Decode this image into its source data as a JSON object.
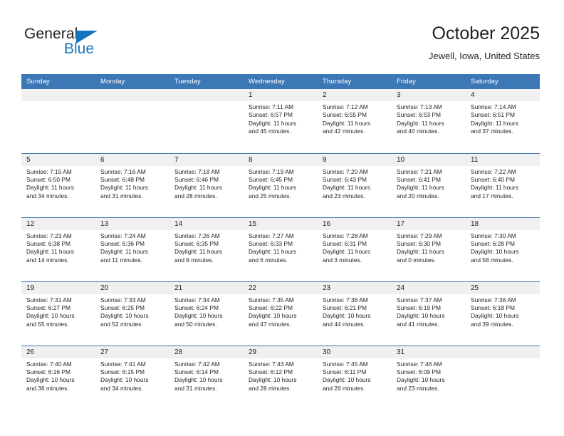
{
  "branding": {
    "logo_text_primary": "General",
    "logo_text_secondary": "Blue",
    "logo_triangle_color": "#1574bc",
    "logo_secondary_color": "#1b75bb"
  },
  "header": {
    "title": "October 2025",
    "subtitle": "Jewell, Iowa, United States"
  },
  "theme": {
    "header_row_bg": "#3c77b6",
    "header_row_text": "#ffffff",
    "daynum_bg": "#f0f0f0",
    "divider_color": "#3c77b6",
    "body_text": "#231f20",
    "page_bg": "#ffffff"
  },
  "calendar": {
    "weekday_headers": [
      "Sunday",
      "Monday",
      "Tuesday",
      "Wednesday",
      "Thursday",
      "Friday",
      "Saturday"
    ],
    "weeks": [
      [
        {
          "day": "",
          "lines": []
        },
        {
          "day": "",
          "lines": []
        },
        {
          "day": "",
          "lines": []
        },
        {
          "day": "1",
          "lines": [
            "Sunrise: 7:11 AM",
            "Sunset: 6:57 PM",
            "Daylight: 11 hours",
            "and 45 minutes."
          ]
        },
        {
          "day": "2",
          "lines": [
            "Sunrise: 7:12 AM",
            "Sunset: 6:55 PM",
            "Daylight: 11 hours",
            "and 42 minutes."
          ]
        },
        {
          "day": "3",
          "lines": [
            "Sunrise: 7:13 AM",
            "Sunset: 6:53 PM",
            "Daylight: 11 hours",
            "and 40 minutes."
          ]
        },
        {
          "day": "4",
          "lines": [
            "Sunrise: 7:14 AM",
            "Sunset: 6:51 PM",
            "Daylight: 11 hours",
            "and 37 minutes."
          ]
        }
      ],
      [
        {
          "day": "5",
          "lines": [
            "Sunrise: 7:15 AM",
            "Sunset: 6:50 PM",
            "Daylight: 11 hours",
            "and 34 minutes."
          ]
        },
        {
          "day": "6",
          "lines": [
            "Sunrise: 7:16 AM",
            "Sunset: 6:48 PM",
            "Daylight: 11 hours",
            "and 31 minutes."
          ]
        },
        {
          "day": "7",
          "lines": [
            "Sunrise: 7:18 AM",
            "Sunset: 6:46 PM",
            "Daylight: 11 hours",
            "and 28 minutes."
          ]
        },
        {
          "day": "8",
          "lines": [
            "Sunrise: 7:19 AM",
            "Sunset: 6:45 PM",
            "Daylight: 11 hours",
            "and 25 minutes."
          ]
        },
        {
          "day": "9",
          "lines": [
            "Sunrise: 7:20 AM",
            "Sunset: 6:43 PM",
            "Daylight: 11 hours",
            "and 23 minutes."
          ]
        },
        {
          "day": "10",
          "lines": [
            "Sunrise: 7:21 AM",
            "Sunset: 6:41 PM",
            "Daylight: 11 hours",
            "and 20 minutes."
          ]
        },
        {
          "day": "11",
          "lines": [
            "Sunrise: 7:22 AM",
            "Sunset: 6:40 PM",
            "Daylight: 11 hours",
            "and 17 minutes."
          ]
        }
      ],
      [
        {
          "day": "12",
          "lines": [
            "Sunrise: 7:23 AM",
            "Sunset: 6:38 PM",
            "Daylight: 11 hours",
            "and 14 minutes."
          ]
        },
        {
          "day": "13",
          "lines": [
            "Sunrise: 7:24 AM",
            "Sunset: 6:36 PM",
            "Daylight: 11 hours",
            "and 11 minutes."
          ]
        },
        {
          "day": "14",
          "lines": [
            "Sunrise: 7:26 AM",
            "Sunset: 6:35 PM",
            "Daylight: 11 hours",
            "and 9 minutes."
          ]
        },
        {
          "day": "15",
          "lines": [
            "Sunrise: 7:27 AM",
            "Sunset: 6:33 PM",
            "Daylight: 11 hours",
            "and 6 minutes."
          ]
        },
        {
          "day": "16",
          "lines": [
            "Sunrise: 7:28 AM",
            "Sunset: 6:31 PM",
            "Daylight: 11 hours",
            "and 3 minutes."
          ]
        },
        {
          "day": "17",
          "lines": [
            "Sunrise: 7:29 AM",
            "Sunset: 6:30 PM",
            "Daylight: 11 hours",
            "and 0 minutes."
          ]
        },
        {
          "day": "18",
          "lines": [
            "Sunrise: 7:30 AM",
            "Sunset: 6:28 PM",
            "Daylight: 10 hours",
            "and 58 minutes."
          ]
        }
      ],
      [
        {
          "day": "19",
          "lines": [
            "Sunrise: 7:31 AM",
            "Sunset: 6:27 PM",
            "Daylight: 10 hours",
            "and 55 minutes."
          ]
        },
        {
          "day": "20",
          "lines": [
            "Sunrise: 7:33 AM",
            "Sunset: 6:25 PM",
            "Daylight: 10 hours",
            "and 52 minutes."
          ]
        },
        {
          "day": "21",
          "lines": [
            "Sunrise: 7:34 AM",
            "Sunset: 6:24 PM",
            "Daylight: 10 hours",
            "and 50 minutes."
          ]
        },
        {
          "day": "22",
          "lines": [
            "Sunrise: 7:35 AM",
            "Sunset: 6:22 PM",
            "Daylight: 10 hours",
            "and 47 minutes."
          ]
        },
        {
          "day": "23",
          "lines": [
            "Sunrise: 7:36 AM",
            "Sunset: 6:21 PM",
            "Daylight: 10 hours",
            "and 44 minutes."
          ]
        },
        {
          "day": "24",
          "lines": [
            "Sunrise: 7:37 AM",
            "Sunset: 6:19 PM",
            "Daylight: 10 hours",
            "and 41 minutes."
          ]
        },
        {
          "day": "25",
          "lines": [
            "Sunrise: 7:38 AM",
            "Sunset: 6:18 PM",
            "Daylight: 10 hours",
            "and 39 minutes."
          ]
        }
      ],
      [
        {
          "day": "26",
          "lines": [
            "Sunrise: 7:40 AM",
            "Sunset: 6:16 PM",
            "Daylight: 10 hours",
            "and 36 minutes."
          ]
        },
        {
          "day": "27",
          "lines": [
            "Sunrise: 7:41 AM",
            "Sunset: 6:15 PM",
            "Daylight: 10 hours",
            "and 34 minutes."
          ]
        },
        {
          "day": "28",
          "lines": [
            "Sunrise: 7:42 AM",
            "Sunset: 6:14 PM",
            "Daylight: 10 hours",
            "and 31 minutes."
          ]
        },
        {
          "day": "29",
          "lines": [
            "Sunrise: 7:43 AM",
            "Sunset: 6:12 PM",
            "Daylight: 10 hours",
            "and 28 minutes."
          ]
        },
        {
          "day": "30",
          "lines": [
            "Sunrise: 7:45 AM",
            "Sunset: 6:11 PM",
            "Daylight: 10 hours",
            "and 26 minutes."
          ]
        },
        {
          "day": "31",
          "lines": [
            "Sunrise: 7:46 AM",
            "Sunset: 6:09 PM",
            "Daylight: 10 hours",
            "and 23 minutes."
          ]
        },
        {
          "day": "",
          "lines": []
        }
      ]
    ]
  }
}
